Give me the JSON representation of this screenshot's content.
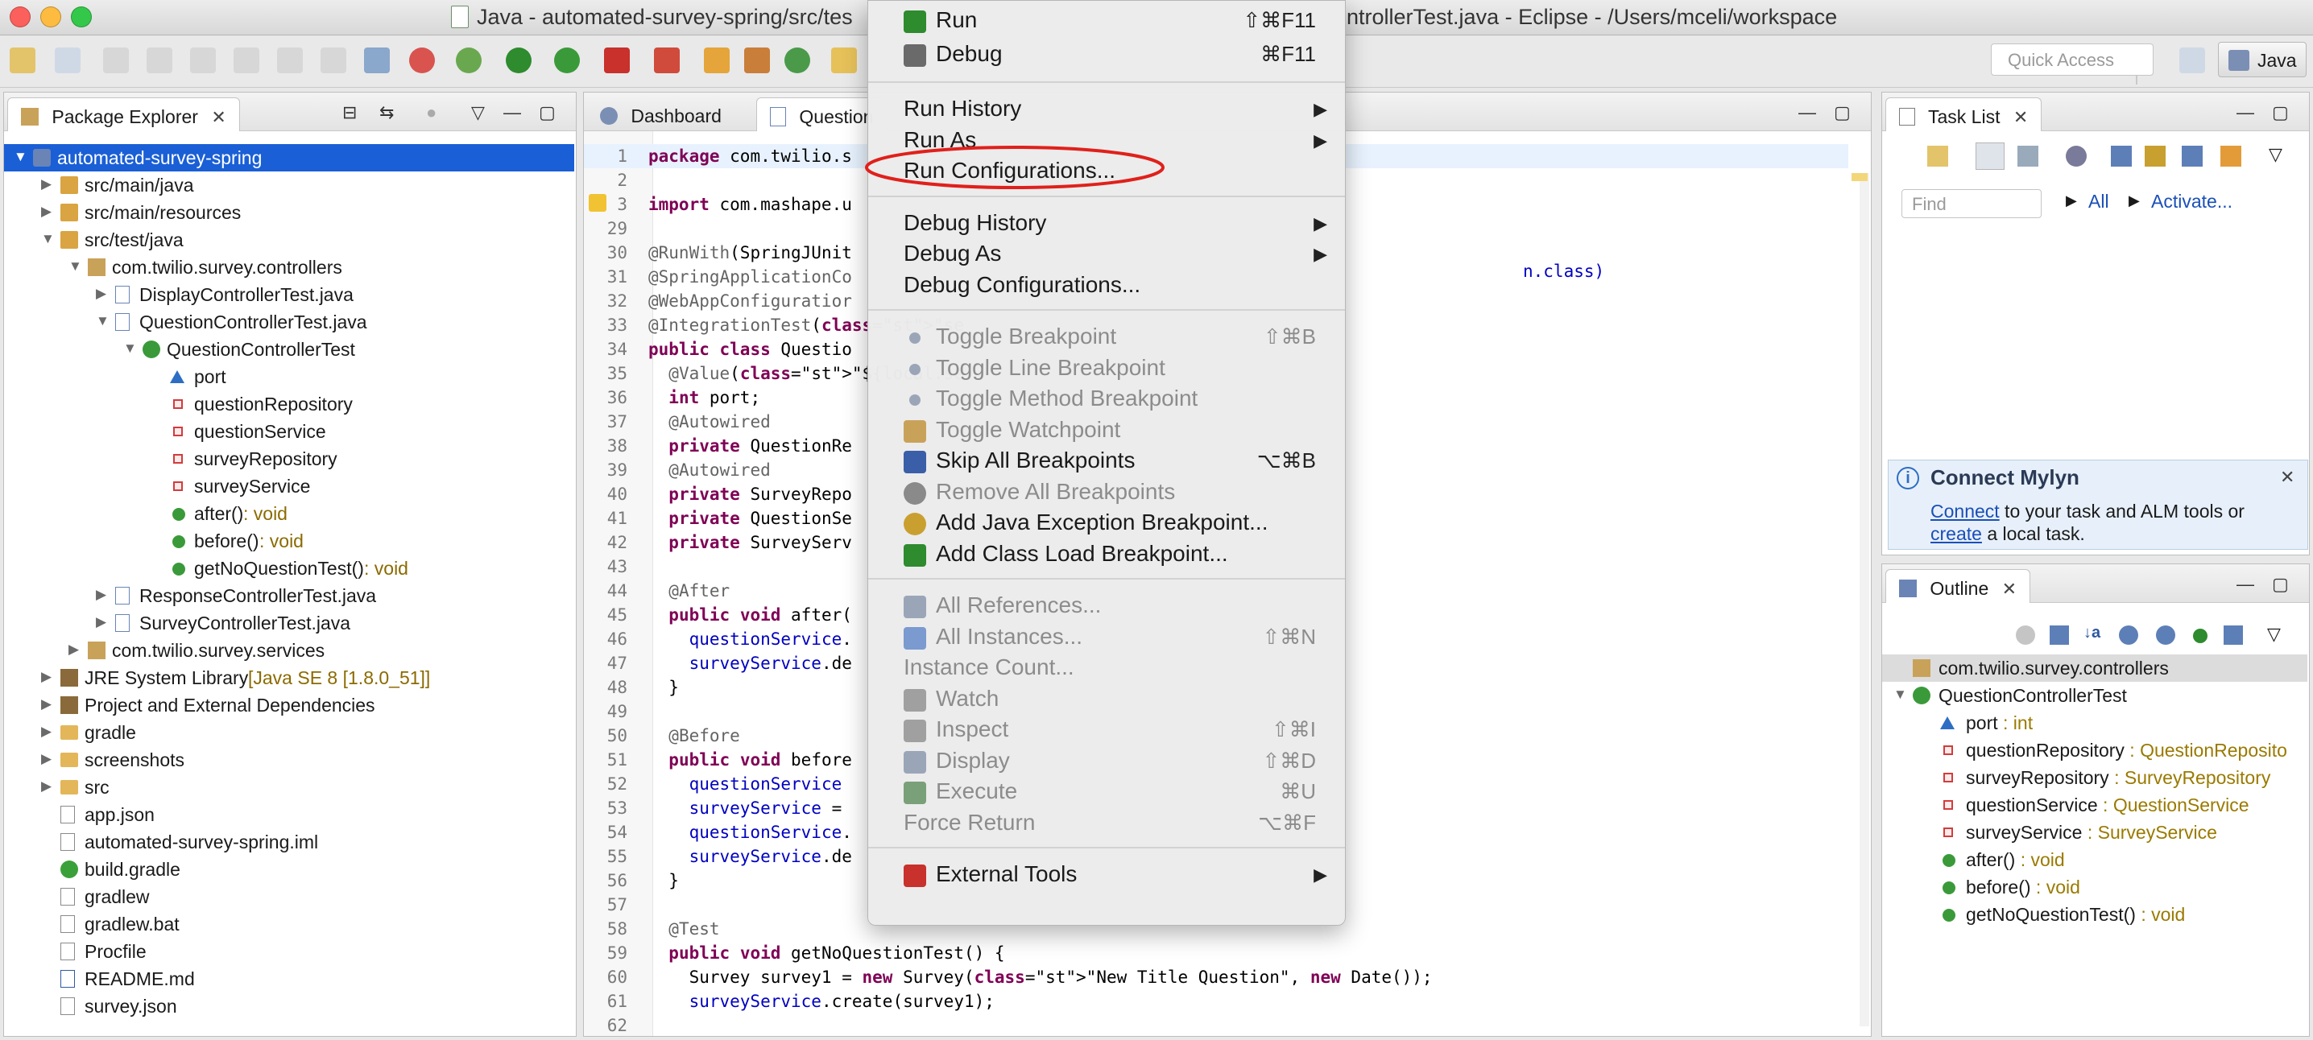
{
  "window": {
    "title_left": "Java - automated-survey-spring/src/tes",
    "title_right": "ntrollerTest.java - Eclipse - /Users/mceli/workspace"
  },
  "toolbar": {
    "quick_access_placeholder": "Quick Access",
    "perspective": "Java"
  },
  "package_explorer": {
    "tab_label": "Package Explorer",
    "tree": [
      {
        "label": "automated-survey-spring",
        "type": "",
        "depth": 0,
        "icon": "project-icon",
        "twisty": "open",
        "selected": true
      },
      {
        "label": "src/main/java",
        "type": "",
        "depth": 1,
        "icon": "source-folder-icon",
        "twisty": "closed"
      },
      {
        "label": "src/main/resources",
        "type": "",
        "depth": 1,
        "icon": "source-folder-icon",
        "twisty": "closed"
      },
      {
        "label": "src/test/java",
        "type": "",
        "depth": 1,
        "icon": "source-folder-icon",
        "twisty": "open"
      },
      {
        "label": "com.twilio.survey.controllers",
        "type": "",
        "depth": 2,
        "icon": "package-icon",
        "twisty": "open"
      },
      {
        "label": "DisplayControllerTest.java",
        "type": "",
        "depth": 3,
        "icon": "java-file-icon",
        "twisty": "closed"
      },
      {
        "label": "QuestionControllerTest.java",
        "type": "",
        "depth": 3,
        "icon": "java-file-icon",
        "twisty": "open"
      },
      {
        "label": "QuestionControllerTest",
        "type": "",
        "depth": 4,
        "icon": "class-icon",
        "twisty": "open"
      },
      {
        "label": "port",
        "type": "",
        "depth": 5,
        "icon": "field-default-icon",
        "twisty": ""
      },
      {
        "label": "questionRepository",
        "type": "",
        "depth": 5,
        "icon": "field-private-icon",
        "twisty": ""
      },
      {
        "label": "questionService",
        "type": "",
        "depth": 5,
        "icon": "field-private-icon",
        "twisty": ""
      },
      {
        "label": "surveyRepository",
        "type": "",
        "depth": 5,
        "icon": "field-private-icon",
        "twisty": ""
      },
      {
        "label": "surveyService",
        "type": "",
        "depth": 5,
        "icon": "field-private-icon",
        "twisty": ""
      },
      {
        "label": "after()",
        "type": " : void",
        "depth": 5,
        "icon": "method-public-icon",
        "twisty": ""
      },
      {
        "label": "before()",
        "type": " : void",
        "depth": 5,
        "icon": "method-public-icon",
        "twisty": ""
      },
      {
        "label": "getNoQuestionTest()",
        "type": " : void",
        "depth": 5,
        "icon": "method-public-icon",
        "twisty": ""
      },
      {
        "label": "ResponseControllerTest.java",
        "type": "",
        "depth": 3,
        "icon": "java-file-icon",
        "twisty": "closed"
      },
      {
        "label": "SurveyControllerTest.java",
        "type": "",
        "depth": 3,
        "icon": "java-file-icon",
        "twisty": "closed"
      },
      {
        "label": "com.twilio.survey.services",
        "type": "",
        "depth": 2,
        "icon": "package-icon",
        "twisty": "closed"
      },
      {
        "label": "JRE System Library",
        "type": " [Java SE 8 [1.8.0_51]]",
        "depth": 1,
        "icon": "library-icon",
        "twisty": "closed"
      },
      {
        "label": "Project and External Dependencies",
        "type": "",
        "depth": 1,
        "icon": "library-icon",
        "twisty": "closed"
      },
      {
        "label": "gradle",
        "type": "",
        "depth": 1,
        "icon": "folder-icon",
        "twisty": "closed"
      },
      {
        "label": "screenshots",
        "type": "",
        "depth": 1,
        "icon": "folder-icon",
        "twisty": "closed"
      },
      {
        "label": "src",
        "type": "",
        "depth": 1,
        "icon": "folder-icon",
        "twisty": "closed"
      },
      {
        "label": "app.json",
        "type": "",
        "depth": 1,
        "icon": "file-icon",
        "twisty": ""
      },
      {
        "label": "automated-survey-spring.iml",
        "type": "",
        "depth": 1,
        "icon": "file-icon",
        "twisty": ""
      },
      {
        "label": "build.gradle",
        "type": "",
        "depth": 1,
        "icon": "gradle-file-icon",
        "twisty": ""
      },
      {
        "label": "gradlew",
        "type": "",
        "depth": 1,
        "icon": "file-icon",
        "twisty": ""
      },
      {
        "label": "gradlew.bat",
        "type": "",
        "depth": 1,
        "icon": "file-icon",
        "twisty": ""
      },
      {
        "label": "Procfile",
        "type": "",
        "depth": 1,
        "icon": "file-icon",
        "twisty": ""
      },
      {
        "label": "README.md",
        "type": "",
        "depth": 1,
        "icon": "word-file-icon",
        "twisty": ""
      },
      {
        "label": "survey.json",
        "type": "",
        "depth": 1,
        "icon": "file-icon",
        "twisty": ""
      }
    ]
  },
  "editor": {
    "tabs": [
      {
        "label": "Dashboard"
      },
      {
        "label": "Question"
      }
    ],
    "lines": [
      {
        "n": "1",
        "code": "package com.twilio.s"
      },
      {
        "n": "2",
        "code": ""
      },
      {
        "n": "3",
        "code": "import com.mashape.u"
      },
      {
        "n": "29",
        "code": ""
      },
      {
        "n": "30",
        "code": "@RunWith(SpringJUnit"
      },
      {
        "n": "31",
        "code": "@SpringApplicationCo"
      },
      {
        "n": "32",
        "code": "@WebAppConfiguratior"
      },
      {
        "n": "33",
        "code": "@IntegrationTest(\"se"
      },
      {
        "n": "34",
        "code": "public class Questio"
      },
      {
        "n": "35",
        "code": "  @Value(\"${local.se"
      },
      {
        "n": "36",
        "code": "  int port;"
      },
      {
        "n": "37",
        "code": "  @Autowired"
      },
      {
        "n": "38",
        "code": "  private QuestionRe"
      },
      {
        "n": "39",
        "code": "  @Autowired"
      },
      {
        "n": "40",
        "code": "  private SurveyRepo"
      },
      {
        "n": "41",
        "code": "  private QuestionSe"
      },
      {
        "n": "42",
        "code": "  private SurveyServ"
      },
      {
        "n": "43",
        "code": ""
      },
      {
        "n": "44",
        "code": "  @After"
      },
      {
        "n": "45",
        "code": "  public void after("
      },
      {
        "n": "46",
        "code": "    questionService."
      },
      {
        "n": "47",
        "code": "    surveyService.de"
      },
      {
        "n": "48",
        "code": "  }"
      },
      {
        "n": "49",
        "code": ""
      },
      {
        "n": "50",
        "code": "  @Before"
      },
      {
        "n": "51",
        "code": "  public void before"
      },
      {
        "n": "52",
        "code": "    questionService"
      },
      {
        "n": "53",
        "code": "    surveyService ="
      },
      {
        "n": "54",
        "code": "    questionService."
      },
      {
        "n": "55",
        "code": "    surveyService.de"
      },
      {
        "n": "56",
        "code": "  }"
      },
      {
        "n": "57",
        "code": ""
      },
      {
        "n": "58",
        "code": "  @Test"
      },
      {
        "n": "59",
        "code": "  public void getNoQuestionTest() {"
      },
      {
        "n": "60",
        "code": "    Survey survey1 = new Survey(\"New Title Question\", new Date());"
      },
      {
        "n": "61",
        "code": "    surveyService.create(survey1);"
      },
      {
        "n": "62",
        "code": ""
      }
    ],
    "line31_tail": "n.class)"
  },
  "run_menu": {
    "items": [
      {
        "label": "Run",
        "shortcut": "⇧⌘F11",
        "icon": "run-icon",
        "disabled": false,
        "submenu": false
      },
      {
        "label": "Debug",
        "shortcut": "⌘F11",
        "icon": "debug-icon",
        "disabled": false,
        "submenu": false
      },
      {
        "sep": true
      },
      {
        "label": "Run History",
        "shortcut": "",
        "icon": "",
        "disabled": false,
        "submenu": true
      },
      {
        "label": "Run As",
        "shortcut": "",
        "icon": "",
        "disabled": false,
        "submenu": true
      },
      {
        "label": "Run Configurations...",
        "shortcut": "",
        "icon": "",
        "disabled": false,
        "submenu": false,
        "highlighted": true
      },
      {
        "sep": true
      },
      {
        "label": "Debug History",
        "shortcut": "",
        "icon": "",
        "disabled": false,
        "submenu": true
      },
      {
        "label": "Debug As",
        "shortcut": "",
        "icon": "",
        "disabled": false,
        "submenu": true
      },
      {
        "label": "Debug Configurations...",
        "shortcut": "",
        "icon": "",
        "disabled": false,
        "submenu": false
      },
      {
        "sep": true
      },
      {
        "label": "Toggle Breakpoint",
        "shortcut": "⇧⌘B",
        "icon": "breakpoint-icon",
        "disabled": true,
        "submenu": false
      },
      {
        "label": "Toggle Line Breakpoint",
        "shortcut": "",
        "icon": "breakpoint-icon",
        "disabled": true,
        "submenu": false
      },
      {
        "label": "Toggle Method Breakpoint",
        "shortcut": "",
        "icon": "breakpoint-icon",
        "disabled": true,
        "submenu": false
      },
      {
        "label": "Toggle Watchpoint",
        "shortcut": "",
        "icon": "watchpoint-icon",
        "disabled": true,
        "submenu": false
      },
      {
        "label": "Skip All Breakpoints",
        "shortcut": "⌥⌘B",
        "icon": "skip-breakpoints-icon",
        "disabled": false,
        "submenu": false
      },
      {
        "label": "Remove All Breakpoints",
        "shortcut": "",
        "icon": "remove-breakpoints-icon",
        "disabled": true,
        "submenu": false
      },
      {
        "label": "Add Java Exception Breakpoint...",
        "shortcut": "",
        "icon": "exception-breakpoint-icon",
        "disabled": false,
        "submenu": false
      },
      {
        "label": "Add Class Load Breakpoint...",
        "shortcut": "",
        "icon": "class-load-icon",
        "disabled": false,
        "submenu": false
      },
      {
        "sep": true
      },
      {
        "label": "All References...",
        "shortcut": "",
        "icon": "references-icon",
        "disabled": true,
        "submenu": false
      },
      {
        "label": "All Instances...",
        "shortcut": "⇧⌘N",
        "icon": "instances-icon",
        "disabled": true,
        "submenu": false
      },
      {
        "label": "Instance Count...",
        "shortcut": "",
        "icon": "",
        "disabled": true,
        "submenu": false
      },
      {
        "label": "Watch",
        "shortcut": "",
        "icon": "watch-icon",
        "disabled": true,
        "submenu": false
      },
      {
        "label": "Inspect",
        "shortcut": "⇧⌘I",
        "icon": "inspect-icon",
        "disabled": true,
        "submenu": false
      },
      {
        "label": "Display",
        "shortcut": "⇧⌘D",
        "icon": "display-icon",
        "disabled": true,
        "submenu": false
      },
      {
        "label": "Execute",
        "shortcut": "⌘U",
        "icon": "execute-icon",
        "disabled": true,
        "submenu": false
      },
      {
        "label": "Force Return",
        "shortcut": "⌥⌘F",
        "icon": "",
        "disabled": true,
        "submenu": false
      },
      {
        "sep": true
      },
      {
        "label": "External Tools",
        "shortcut": "",
        "icon": "external-tools-icon",
        "disabled": false,
        "submenu": true
      }
    ]
  },
  "task_list": {
    "tab_label": "Task List",
    "find_placeholder": "Find",
    "all_link": "All",
    "activate_link": "Activate..."
  },
  "mylyn": {
    "title": "Connect Mylyn",
    "connect_link": "Connect",
    "text1": " to your task and ALM tools or",
    "create_link": "create",
    "text2": " a local task."
  },
  "outline": {
    "tab_label": "Outline",
    "rows": [
      {
        "label": "com.twilio.survey.controllers",
        "type": "",
        "depth": 0,
        "icon": "package-icon",
        "twisty": "",
        "selected": true
      },
      {
        "label": "QuestionControllerTest",
        "type": "",
        "depth": 0,
        "icon": "class-icon",
        "twisty": "open"
      },
      {
        "label": "port",
        "type": " : int",
        "depth": 1,
        "icon": "field-default-icon",
        "twisty": ""
      },
      {
        "label": "questionRepository",
        "type": " : QuestionReposito",
        "depth": 1,
        "icon": "field-private-icon",
        "twisty": ""
      },
      {
        "label": "surveyRepository",
        "type": " : SurveyRepository",
        "depth": 1,
        "icon": "field-private-icon",
        "twisty": ""
      },
      {
        "label": "questionService",
        "type": " : QuestionService",
        "depth": 1,
        "icon": "field-private-icon",
        "twisty": ""
      },
      {
        "label": "surveyService",
        "type": " : SurveyService",
        "depth": 1,
        "icon": "field-private-icon",
        "twisty": ""
      },
      {
        "label": "after()",
        "type": " : void",
        "depth": 1,
        "icon": "method-public-icon",
        "twisty": ""
      },
      {
        "label": "before()",
        "type": " : void",
        "depth": 1,
        "icon": "method-public-icon",
        "twisty": ""
      },
      {
        "label": "getNoQuestionTest()",
        "type": " : void",
        "depth": 1,
        "icon": "method-public-icon",
        "twisty": ""
      }
    ]
  },
  "colors": {
    "selection": "#1a5fd6",
    "highlight_ellipse": "#e0201b",
    "link": "#1a4fb8"
  }
}
